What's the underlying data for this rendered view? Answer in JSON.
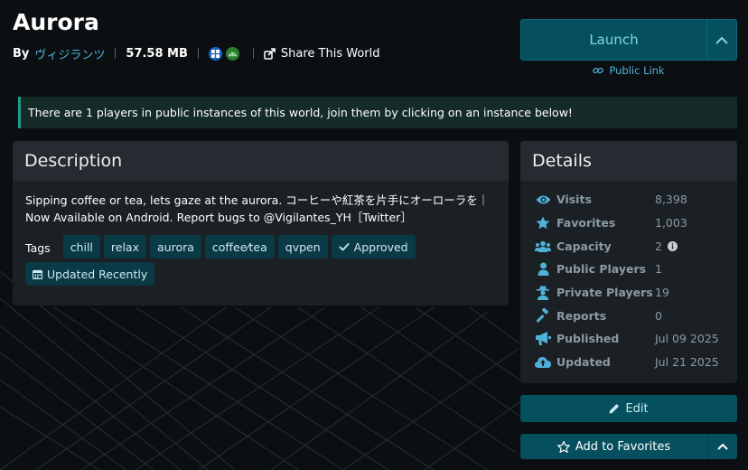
{
  "world": {
    "title": "Aurora",
    "by_label": "By",
    "author": "ヴィジランツ",
    "size": "57.58 MB",
    "share_label": "Share This World"
  },
  "actions": {
    "launch_label": "Launch",
    "public_link_label": "Public Link",
    "edit_label": "Edit",
    "favorites_label": "Add to Favorites"
  },
  "banner": {
    "text": "There are 1 players in public instances of this world, join them by clicking on an instance below!"
  },
  "description": {
    "heading": "Description",
    "text": "Sipping coffee or tea, lets gaze at the aurora. コーヒーや紅茶を片手にオーローラを｜Now Available on Android. Report bugs to @Vigilantes_YH［Twitter］",
    "tags_label": "Tags",
    "tags": [
      "chill",
      "relax",
      "aurora",
      "coffee⁄tea",
      "qvpen"
    ],
    "approved_label": "Approved",
    "updated_recently_label": "Updated Recently"
  },
  "details": {
    "heading": "Details",
    "rows": [
      {
        "label": "Visits",
        "value": "8,398",
        "icon": "eye-icon"
      },
      {
        "label": "Favorites",
        "value": "1,003",
        "icon": "star-icon"
      },
      {
        "label": "Capacity",
        "value": "2",
        "icon": "users-icon"
      },
      {
        "label": "Public Players",
        "value": "1",
        "icon": "user-icon"
      },
      {
        "label": "Private Players",
        "value": "19",
        "icon": "incognito-icon"
      },
      {
        "label": "Reports",
        "value": "0",
        "icon": "gavel-icon"
      },
      {
        "label": "Published",
        "value": "Jul 09 2025",
        "icon": "megaphone-icon"
      },
      {
        "label": "Updated",
        "value": "Jul 21 2025",
        "icon": "cloud-upload-icon"
      }
    ]
  },
  "colors": {
    "accent": "#064f5e",
    "link": "#4fb3d9",
    "banner_border": "#1f9b86",
    "icon": "#4fb3d9"
  }
}
